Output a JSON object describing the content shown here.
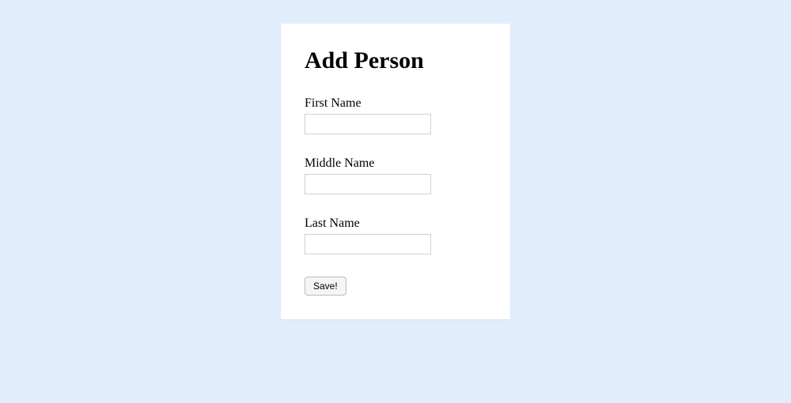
{
  "form": {
    "title": "Add Person",
    "fields": {
      "first_name": {
        "label": "First Name",
        "value": ""
      },
      "middle_name": {
        "label": "Middle Name",
        "value": ""
      },
      "last_name": {
        "label": "Last Name",
        "value": ""
      }
    },
    "save_button_label": "Save!"
  }
}
